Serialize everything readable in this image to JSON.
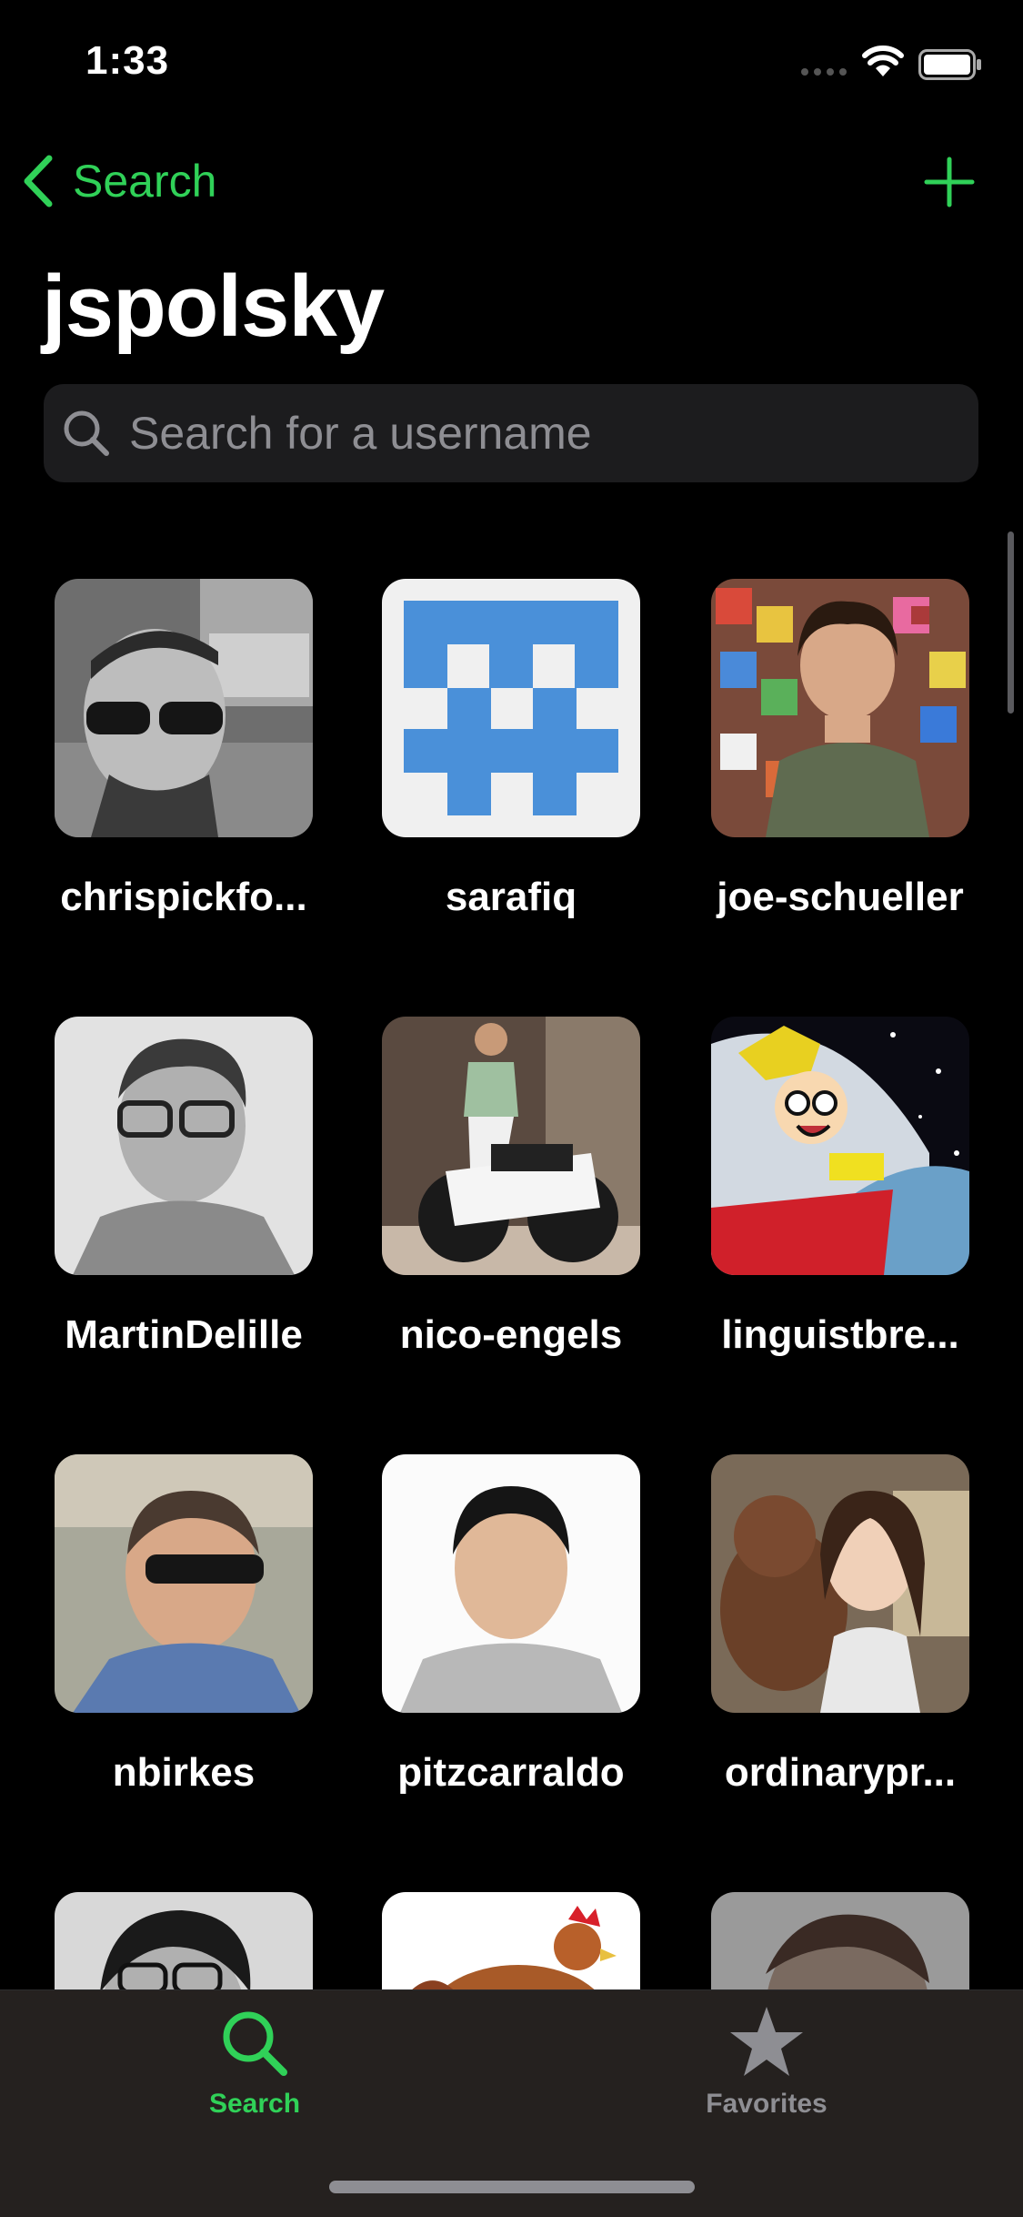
{
  "status_bar": {
    "time": "1:33"
  },
  "nav": {
    "back_label": "Search",
    "title": "jspolsky"
  },
  "search": {
    "placeholder": "Search for a username",
    "value": ""
  },
  "users": [
    {
      "name": "chrispickfo..."
    },
    {
      "name": "sarafiq"
    },
    {
      "name": "joe-schueller"
    },
    {
      "name": "MartinDelille"
    },
    {
      "name": "nico-engels"
    },
    {
      "name": "linguistbre..."
    },
    {
      "name": "nbirkes"
    },
    {
      "name": "pitzcarraldo"
    },
    {
      "name": "ordinarypr..."
    },
    {
      "name": ""
    },
    {
      "name": ""
    },
    {
      "name": ""
    }
  ],
  "tabs": [
    {
      "label": "Search",
      "icon": "search-icon",
      "selected": true
    },
    {
      "label": "Favorites",
      "icon": "star-icon",
      "selected": false
    }
  ],
  "colors": {
    "accent": "#30d158",
    "inactive": "#8e8e93",
    "background": "#000000"
  }
}
